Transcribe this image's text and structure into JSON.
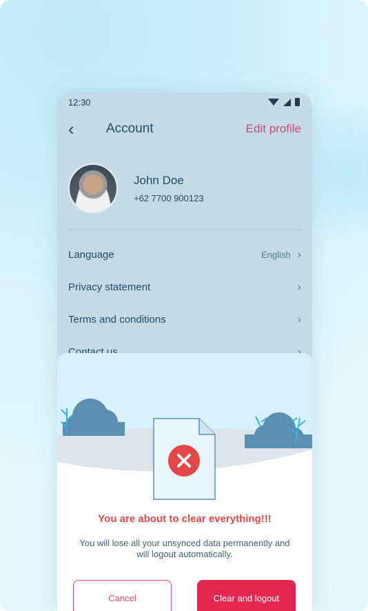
{
  "status_bar": {
    "time": "12:30"
  },
  "header": {
    "title": "Account",
    "edit_label": "Edit profile"
  },
  "profile": {
    "name": "John Doe",
    "phone": "+62 7700 900123"
  },
  "menu": [
    {
      "label": "Language",
      "value": "English"
    },
    {
      "label": "Privacy statement"
    },
    {
      "label": "Terms and conditions"
    },
    {
      "label": "Contact us"
    }
  ],
  "dialog": {
    "title": "You are about to clear everything!!!",
    "message": "You will lose all your unsynced data permanently and will logout automatically.",
    "cancel_label": "Cancel",
    "confirm_label": "Clear and logout",
    "icon": "error-x-icon"
  },
  "colors": {
    "accent_pink": "#c84a75",
    "danger": "#e2264f",
    "primary_text": "#1f4a66"
  }
}
